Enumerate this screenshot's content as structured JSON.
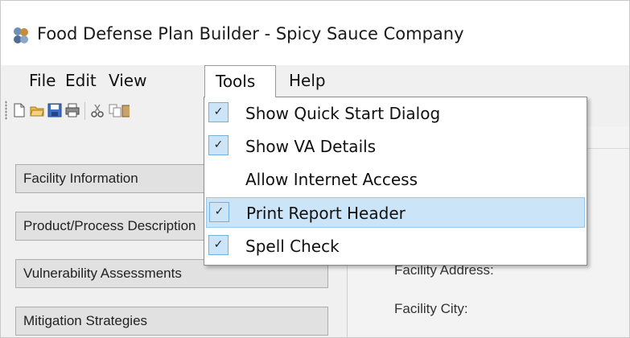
{
  "window": {
    "title": "Food Defense Plan Builder - Spicy Sauce Company",
    "app_icon": "app-logo-icon"
  },
  "menubar": {
    "items": [
      {
        "label": "File"
      },
      {
        "label": "Edit"
      },
      {
        "label": "View"
      },
      {
        "label": "Tools"
      },
      {
        "label": "Help"
      }
    ],
    "open_menu": "Tools"
  },
  "toolbar": {
    "icons": [
      "new-document-icon",
      "open-folder-icon",
      "save-icon",
      "print-icon",
      "cut-icon",
      "copy-icon",
      "paste-icon"
    ]
  },
  "tools_menu": {
    "items": [
      {
        "label": "Show Quick Start Dialog",
        "checked": true,
        "highlighted": false
      },
      {
        "label": "Show VA Details",
        "checked": true,
        "highlighted": false
      },
      {
        "label": "Allow Internet Access",
        "checked": false,
        "highlighted": false
      },
      {
        "label": "Print Report Header",
        "checked": true,
        "highlighted": true
      },
      {
        "label": "Spell Check",
        "checked": true,
        "highlighted": false
      }
    ],
    "check_glyph": "✓"
  },
  "sidebar": {
    "items": [
      {
        "label": "Facility Information"
      },
      {
        "label": "Product/Process Description"
      },
      {
        "label": "Vulnerability Assessments"
      },
      {
        "label": "Mitigation Strategies"
      }
    ]
  },
  "main": {
    "fields": [
      {
        "label": "Facility Address:"
      },
      {
        "label": "Facility City:"
      }
    ]
  },
  "colors": {
    "highlight": "#cce4f7",
    "highlight_border": "#99c9ef",
    "check_border": "#6fb1e3"
  }
}
